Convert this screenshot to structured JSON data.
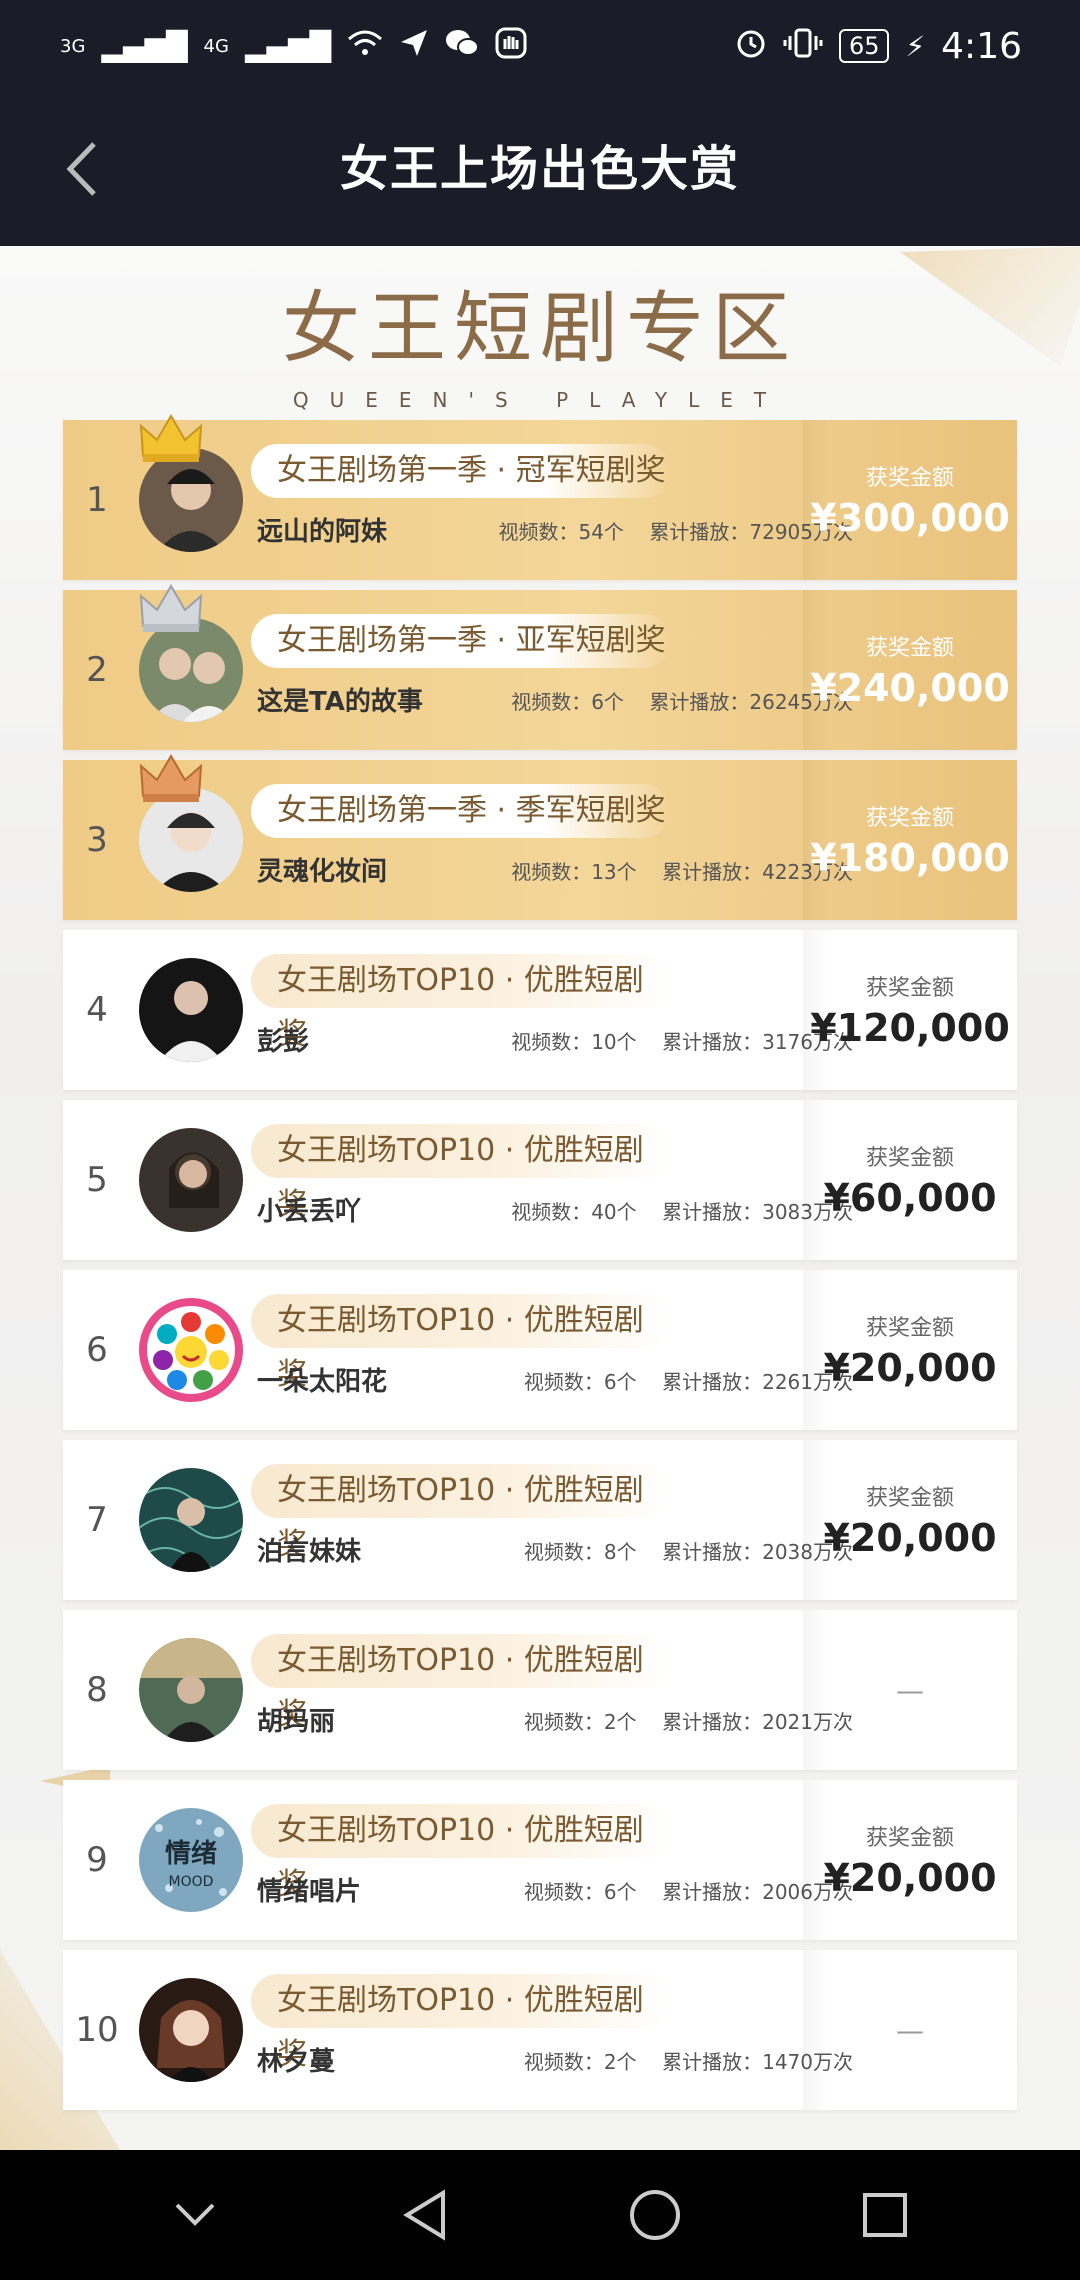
{
  "status_bar": {
    "signal1": "3G",
    "signal2": "4G",
    "battery": "65",
    "time": "4:16"
  },
  "header": {
    "title": "女王上场出色大赏"
  },
  "section": {
    "title": "女王短剧专区",
    "subtitle": "QUEEN'S PLAYLET"
  },
  "ranking": [
    {
      "rank": "1",
      "award": "女王剧场第一季 · 冠军短剧奖",
      "name": "远山的阿妹",
      "videos": "视频数：54个",
      "plays": "累计播放：72905万次",
      "prize_label": "获奖金额",
      "prize": "¥300,000",
      "crown": "gold"
    },
    {
      "rank": "2",
      "award": "女王剧场第一季 · 亚军短剧奖",
      "name": "这是TA的故事",
      "videos": "视频数：6个",
      "plays": "累计播放：26245万次",
      "prize_label": "获奖金额",
      "prize": "¥240,000",
      "crown": "silver"
    },
    {
      "rank": "3",
      "award": "女王剧场第一季 · 季军短剧奖",
      "name": "灵魂化妆间",
      "videos": "视频数：13个",
      "plays": "累计播放：4223万次",
      "prize_label": "获奖金额",
      "prize": "¥180,000",
      "crown": "bronze"
    },
    {
      "rank": "4",
      "award": "女王剧场TOP10 · 优胜短剧奖",
      "name": "彭彭",
      "videos": "视频数：10个",
      "plays": "累计播放：3176万次",
      "prize_label": "获奖金额",
      "prize": "¥120,000"
    },
    {
      "rank": "5",
      "award": "女王剧场TOP10 · 优胜短剧奖",
      "name": "小丢丢吖",
      "videos": "视频数：40个",
      "plays": "累计播放：3083万次",
      "prize_label": "获奖金额",
      "prize": "¥60,000"
    },
    {
      "rank": "6",
      "award": "女王剧场TOP10 · 优胜短剧奖",
      "name": "一朵太阳花",
      "videos": "视频数：6个",
      "plays": "累计播放：2261万次",
      "prize_label": "获奖金额",
      "prize": "¥20,000"
    },
    {
      "rank": "7",
      "award": "女王剧场TOP10 · 优胜短剧奖",
      "name": "泊言妹妹",
      "videos": "视频数：8个",
      "plays": "累计播放：2038万次",
      "prize_label": "获奖金额",
      "prize": "¥20,000"
    },
    {
      "rank": "8",
      "award": "女王剧场TOP10 · 优胜短剧奖",
      "name": "胡玛丽",
      "videos": "视频数：2个",
      "plays": "累计播放：2021万次",
      "prize_label": "",
      "prize": "—"
    },
    {
      "rank": "9",
      "award": "女王剧场TOP10 · 优胜短剧奖",
      "name": "情绪唱片",
      "videos": "视频数：6个",
      "plays": "累计播放：2006万次",
      "prize_label": "获奖金额",
      "prize": "¥20,000"
    },
    {
      "rank": "10",
      "award": "女王剧场TOP10 · 优胜短剧奖",
      "name": "林夕蔓",
      "videos": "视频数：2个",
      "plays": "累计播放：1470万次",
      "prize_label": "",
      "prize": "—"
    }
  ],
  "colors": {
    "header_bg": "#1b1c27",
    "gold_card": "#efcb86",
    "section_title": "#8b6b48"
  }
}
